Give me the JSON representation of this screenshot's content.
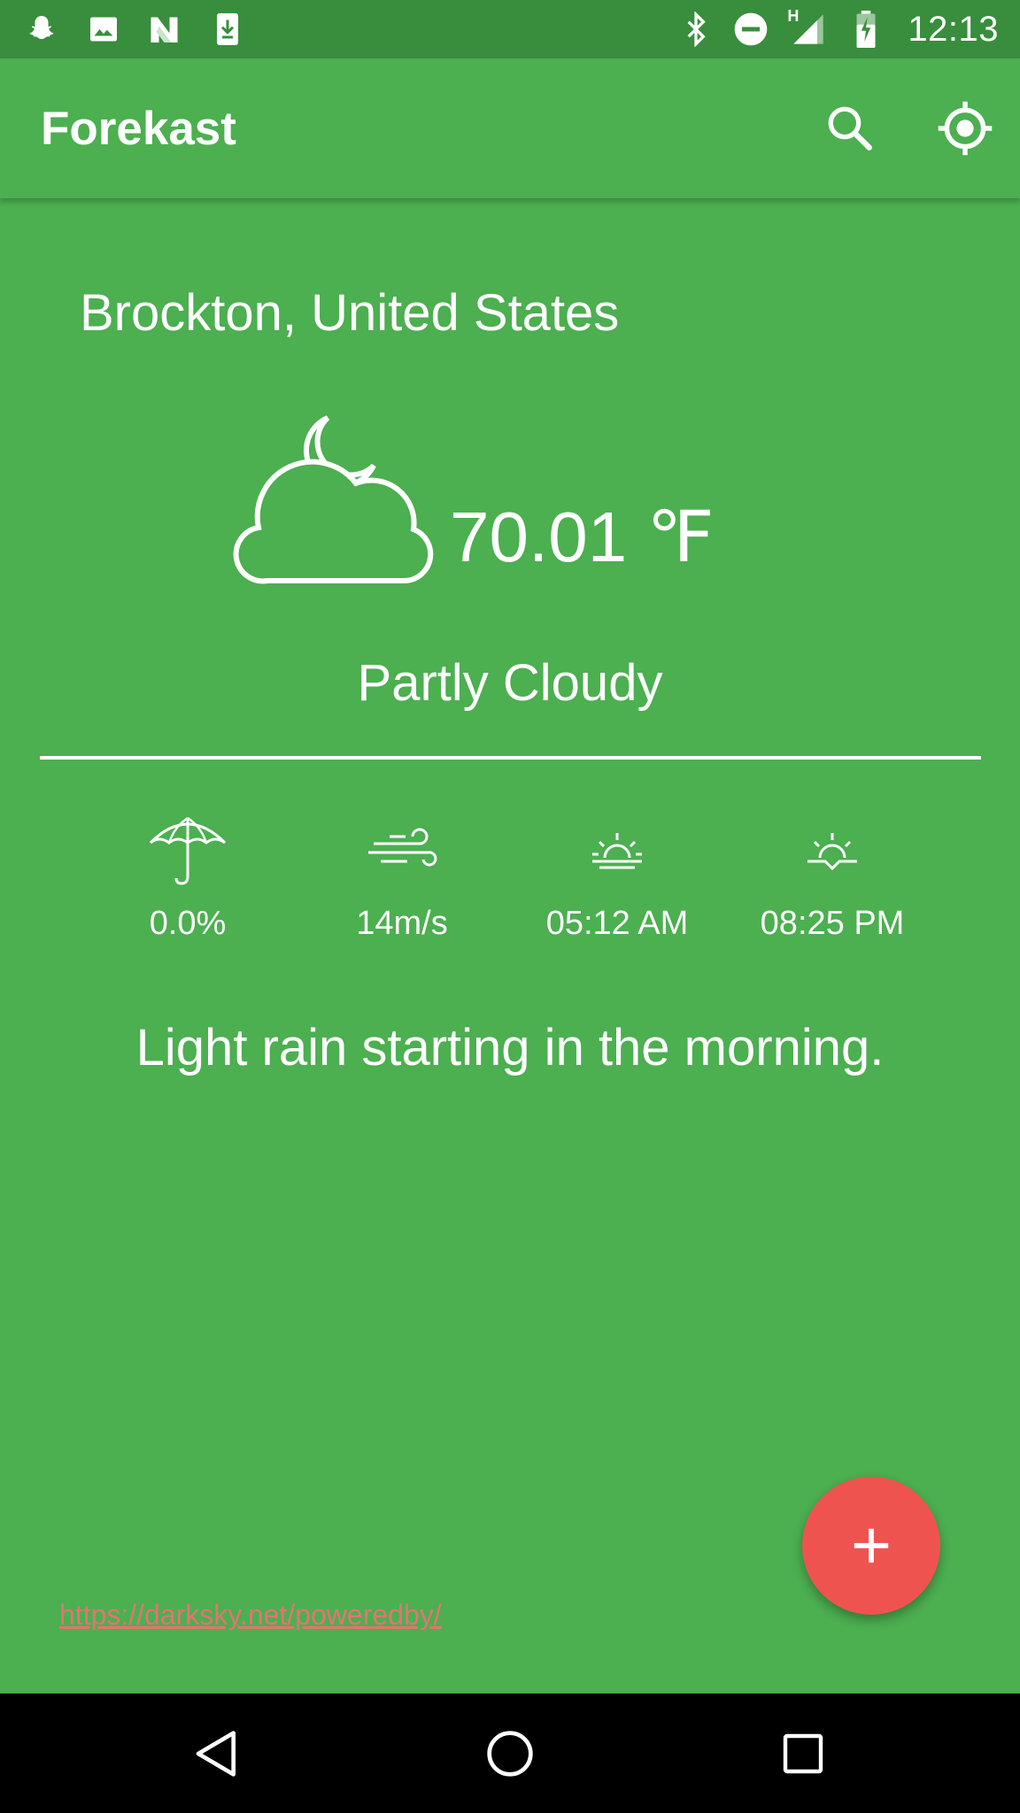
{
  "status_bar": {
    "time": "12:13",
    "network_label": "H",
    "left_icons": [
      "snapchat-icon",
      "image-icon",
      "n-app-icon",
      "download-icon"
    ],
    "right_icons": [
      "bluetooth-icon",
      "do-not-disturb-icon",
      "signal-icon",
      "battery-charging-icon"
    ]
  },
  "app_bar": {
    "title": "Forekast",
    "actions": [
      "search-icon",
      "my-location-icon"
    ]
  },
  "weather": {
    "location": "Brockton, United States",
    "temperature": "70.01 ℉",
    "summary": "Partly Cloudy",
    "icon": "partly-cloudy-night-icon"
  },
  "stats": [
    {
      "icon": "umbrella-icon",
      "value": "0.0%"
    },
    {
      "icon": "wind-icon",
      "value": "14m/s"
    },
    {
      "icon": "sunrise-icon",
      "value": "05:12 AM"
    },
    {
      "icon": "sunset-icon",
      "value": "08:25 PM"
    }
  ],
  "forecast_text": "Light rain starting in the morning.",
  "powered_by": "https://darksky.net/poweredby/",
  "fab_icon": "add-icon",
  "nav": [
    "back-icon",
    "home-icon",
    "recents-icon"
  ],
  "colors": {
    "primary": "#4caf50",
    "status_bar": "#388e3c",
    "accent": "#ef5350",
    "link": "#e57373"
  }
}
